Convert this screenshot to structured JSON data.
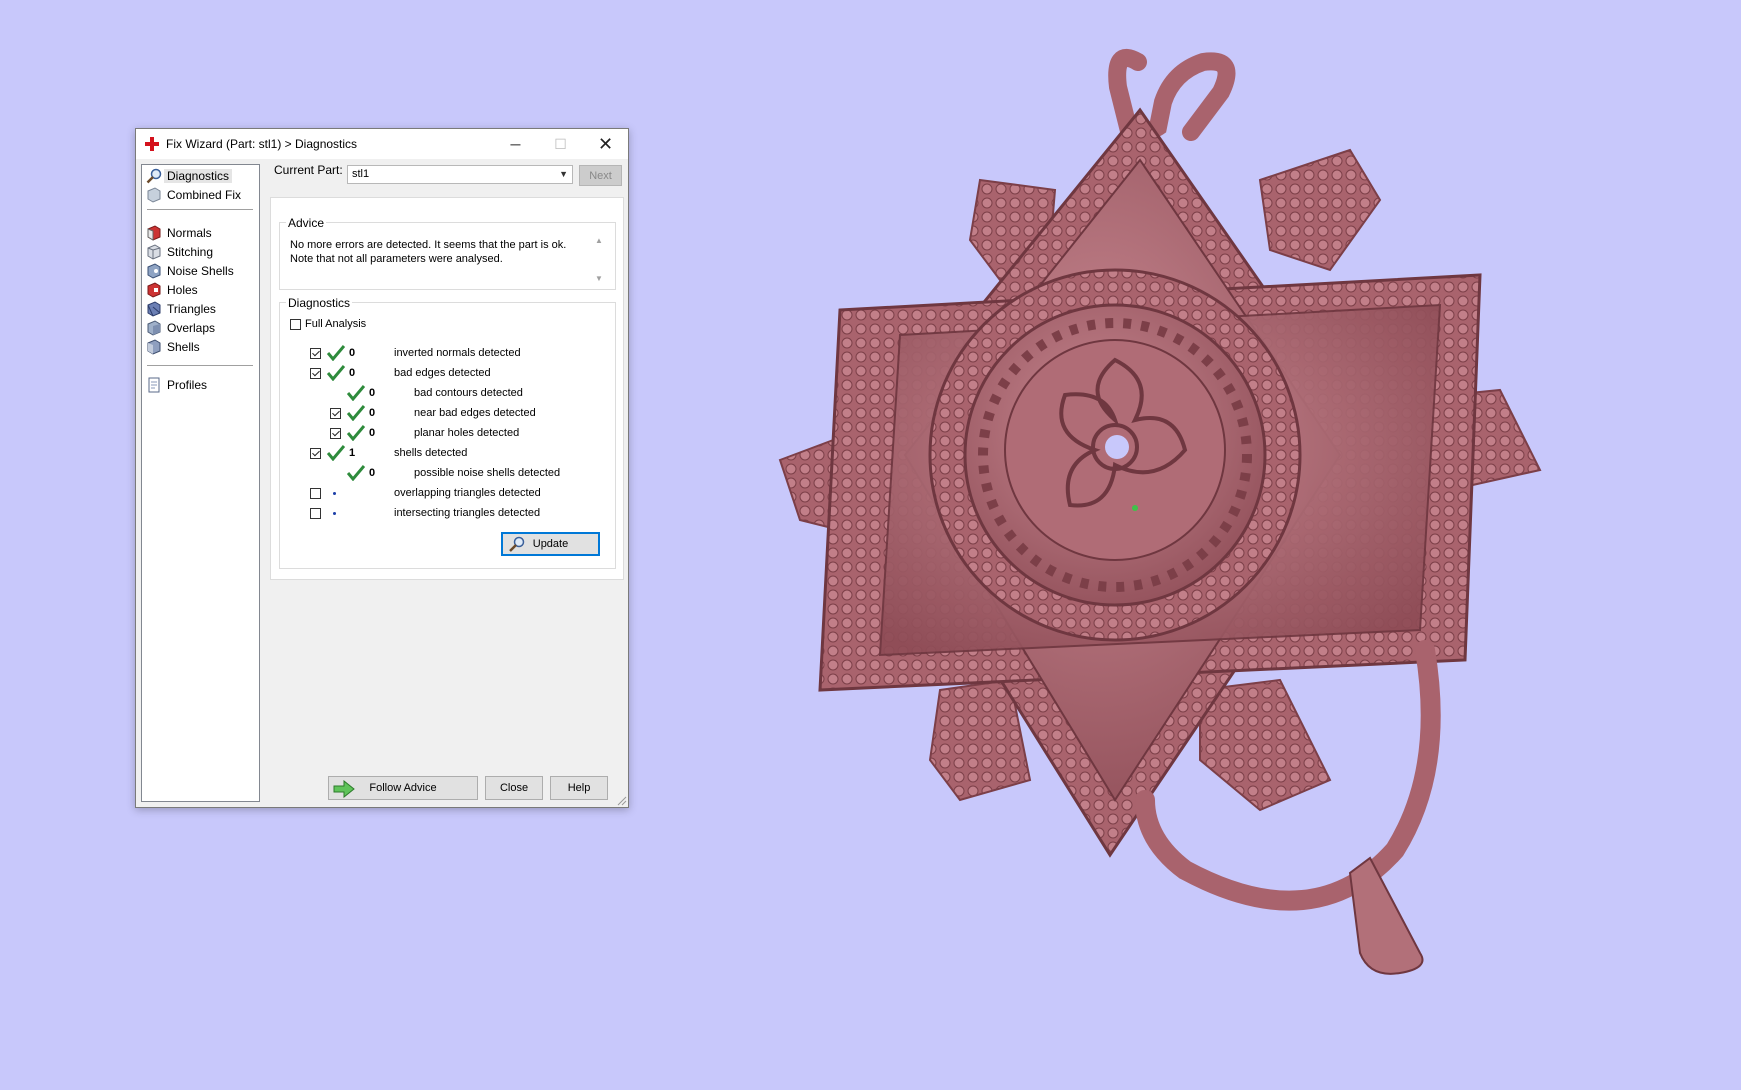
{
  "dialog": {
    "title": "Fix Wizard (Part: stl1) > Diagnostics",
    "window_controls": {
      "minimize": "─",
      "maximize": "☐",
      "close": "✕"
    }
  },
  "sidebar": {
    "items": [
      {
        "label": "Diagnostics",
        "icon": "magnifier-icon",
        "selected": true
      },
      {
        "label": "Combined Fix",
        "icon": "combined-fix-icon"
      },
      {
        "label": "Normals",
        "icon": "normals-cube-icon"
      },
      {
        "label": "Stitching",
        "icon": "stitching-cube-icon"
      },
      {
        "label": "Noise Shells",
        "icon": "noise-shells-cube-icon"
      },
      {
        "label": "Holes",
        "icon": "holes-cube-icon"
      },
      {
        "label": "Triangles",
        "icon": "triangles-cube-icon"
      },
      {
        "label": "Overlaps",
        "icon": "overlaps-cube-icon"
      },
      {
        "label": "Shells",
        "icon": "shells-cube-icon"
      },
      {
        "label": "Profiles",
        "icon": "profiles-page-icon"
      }
    ]
  },
  "current_part": {
    "label": "Current Part:",
    "value": "stl1",
    "next_label": "Next"
  },
  "advice": {
    "title": "Advice",
    "line1": "No more errors are detected. It seems that the part is ok.",
    "line2": "Note that not all parameters were analysed."
  },
  "diagnostics": {
    "title": "Diagnostics",
    "full_analysis": {
      "label": "Full Analysis",
      "checked": false
    },
    "rows": [
      {
        "checked": true,
        "ok": true,
        "count": "0",
        "label": "inverted normals detected"
      },
      {
        "checked": true,
        "ok": true,
        "count": "0",
        "label": "bad edges detected"
      },
      {
        "ok": true,
        "count": "0",
        "label": "bad contours detected"
      },
      {
        "checked": true,
        "ok": true,
        "count": "0",
        "label": "near bad edges detected"
      },
      {
        "checked": true,
        "ok": true,
        "count": "0",
        "label": "planar holes detected"
      },
      {
        "checked": true,
        "ok": true,
        "count": "1",
        "label": "shells detected"
      },
      {
        "ok": true,
        "count": "0",
        "label": "possible noise shells detected"
      },
      {
        "checked": false,
        "ok": false,
        "count": "",
        "label": "overlapping triangles detected"
      },
      {
        "checked": false,
        "ok": false,
        "count": "",
        "label": "intersecting triangles detected"
      }
    ],
    "update_label": "Update"
  },
  "footer": {
    "follow_advice_label": "Follow Advice",
    "close_label": "Close",
    "help_label": "Help"
  },
  "colors": {
    "background": "#c8c8fb",
    "model": "#b8707a",
    "check_green": "#2e8b3c",
    "focus_blue": "#0078d7"
  }
}
